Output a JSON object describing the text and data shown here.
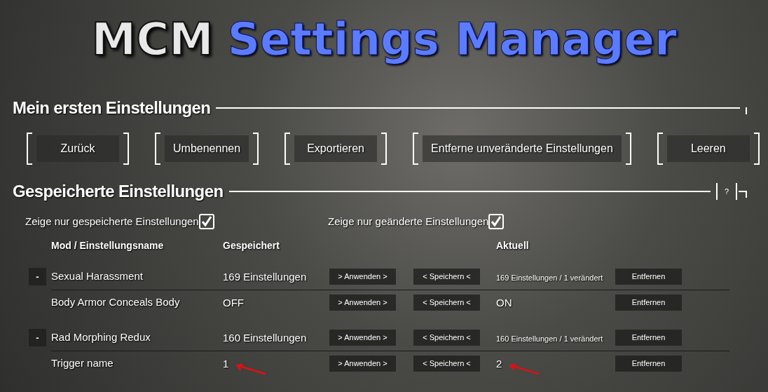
{
  "title": {
    "left": "MCM",
    "right": "Settings Manager"
  },
  "profile": {
    "heading": "Mein ersten Einstellungen",
    "buttons": [
      "Zurück",
      "Umbenennen",
      "Exportieren",
      "Entferne unveränderte Einstellungen",
      "Leeren"
    ]
  },
  "saved": {
    "heading": "Gespeicherte Einstellungen",
    "help": "?",
    "filters": [
      {
        "label": "Zeige nur gespeicherte Einstellungen",
        "checked": true
      },
      {
        "label": "Zeige nur geänderte Einstellungen",
        "checked": true
      }
    ],
    "columns": [
      "Mod / Einstellungsname",
      "Gespeichert",
      "Aktuell"
    ],
    "mods": [
      {
        "toggle": "-",
        "name": "Sexual Harassment",
        "saved": "169 Einstellungen",
        "apply": "> Anwenden >",
        "store": "< Speichern <",
        "current": "169 Einstellungen / 1 verändert",
        "remove": "Entfernen",
        "children": [
          {
            "name": "Body Armor Conceals Body",
            "saved": "OFF",
            "apply": "> Anwenden >",
            "store": "< Speichern <",
            "current": "ON",
            "remove": "Entfernen",
            "marked": false
          }
        ]
      },
      {
        "toggle": "-",
        "name": "Rad Morphing Redux",
        "saved": "160 Einstellungen",
        "apply": "> Anwenden >",
        "store": "< Speichern <",
        "current": "160 Einstellungen / 1 verändert",
        "remove": "Entfernen",
        "children": [
          {
            "name": "Trigger name",
            "saved": "1",
            "apply": "> Anwenden >",
            "store": "< Speichern <",
            "current": "2",
            "remove": "Entfernen",
            "marked": true
          }
        ]
      }
    ]
  }
}
